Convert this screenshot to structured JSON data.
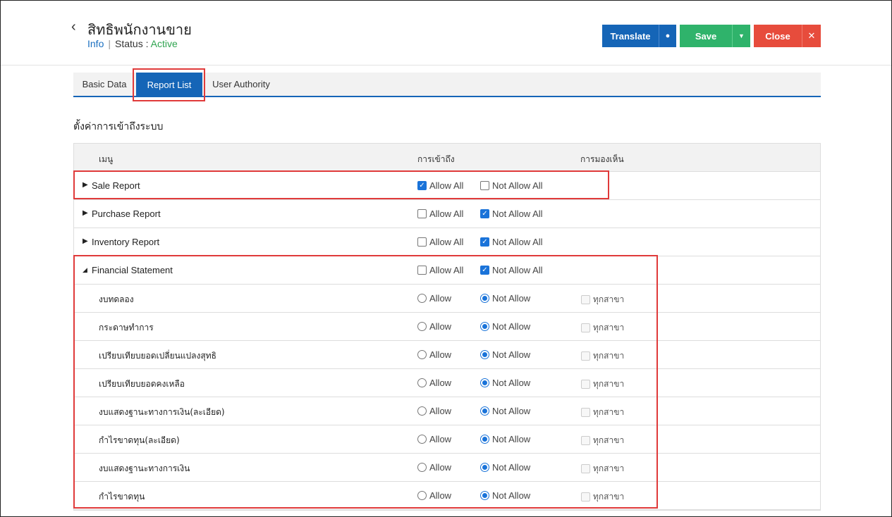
{
  "header": {
    "title": "สิทธิพนักงานขาย",
    "info_label": "Info",
    "status_label": "Status",
    "status_value": "Active",
    "buttons": {
      "translate": "Translate",
      "save": "Save",
      "close": "Close"
    }
  },
  "tabs": [
    {
      "label": "Basic Data",
      "active": false
    },
    {
      "label": "Report List",
      "active": true
    },
    {
      "label": "User Authority",
      "active": false
    }
  ],
  "section_title": "ตั้งค่าการเข้าถึงระบบ",
  "table": {
    "headers": {
      "menu": "เมนู",
      "access": "การเข้าถึง",
      "visibility": "การมองเห็น"
    },
    "parents": [
      {
        "label": "Sale Report",
        "expanded": false,
        "allow_all": true,
        "not_allow_all": false
      },
      {
        "label": "Purchase Report",
        "expanded": false,
        "allow_all": false,
        "not_allow_all": true
      },
      {
        "label": "Inventory Report",
        "expanded": false,
        "allow_all": false,
        "not_allow_all": true
      },
      {
        "label": "Financial Statement",
        "expanded": true,
        "allow_all": false,
        "not_allow_all": true
      }
    ],
    "allow_all_label": "Allow All",
    "not_allow_all_label": "Not Allow All",
    "allow_label": "Allow",
    "not_allow_label": "Not Allow",
    "branch_label": "ทุกสาขา",
    "children": [
      {
        "label": "งบทดลอง",
        "allow": false
      },
      {
        "label": "กระดาษทำการ",
        "allow": false
      },
      {
        "label": "เปรียบเทียบยอดเปลี่ยนแปลงสุทธิ",
        "allow": false
      },
      {
        "label": "เปรียบเทียบยอดคงเหลือ",
        "allow": false
      },
      {
        "label": "งบแสดงฐานะทางการเงิน(ละเอียด)",
        "allow": false
      },
      {
        "label": "กำไรขาดทุน(ละเอียด)",
        "allow": false
      },
      {
        "label": "งบแสดงฐานะทางการเงิน",
        "allow": false
      },
      {
        "label": "กำไรขาดทุน",
        "allow": false
      }
    ]
  }
}
